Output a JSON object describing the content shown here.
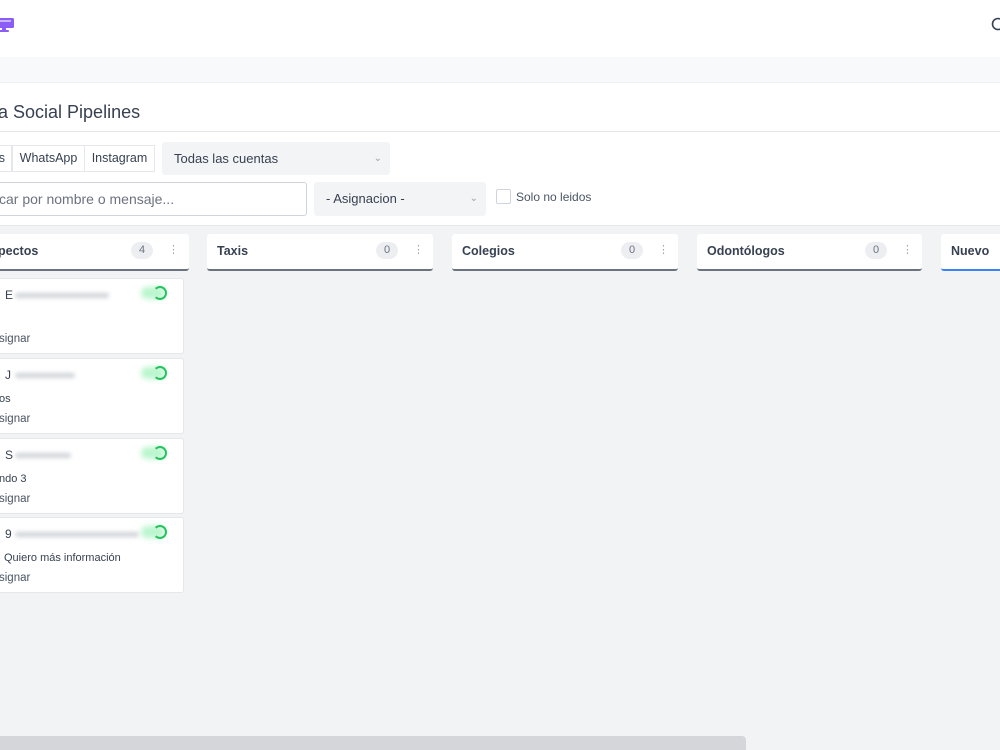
{
  "header": {
    "logo_icon": "monitor-icon",
    "logo_color": "#8b5cf6",
    "search_icon": "search-icon"
  },
  "page": {
    "title": "a Social Pipelines"
  },
  "filters": {
    "channel_tabs": [
      {
        "label": "s"
      },
      {
        "label": "WhatsApp"
      },
      {
        "label": "Instagram"
      }
    ],
    "accounts_select": "Todas las cuentas",
    "search_placeholder": "car por nombre o mensaje...",
    "assignment_select": "- Asignacion -",
    "unread_label": "Solo no leidos"
  },
  "columns": [
    {
      "title": "pectos",
      "count": "4"
    },
    {
      "title": "Taxis",
      "count": "0"
    },
    {
      "title": "Colegios",
      "count": "0"
    },
    {
      "title": "Odontólogos",
      "count": "0"
    },
    {
      "title": "Nuevo",
      "count": ""
    }
  ],
  "cards": [
    {
      "initial": "E",
      "message": "",
      "assign": "signar"
    },
    {
      "initial": "J",
      "message": "os",
      "assign": "signar"
    },
    {
      "initial": "S",
      "message": "ndo 3",
      "assign": "signar"
    },
    {
      "initial": "9",
      "message": "Quiero más información",
      "assign": "signar"
    }
  ],
  "colors": {
    "accent": "#3b82f6",
    "status_online": "#22c55e",
    "column_border": "#6b7280"
  }
}
